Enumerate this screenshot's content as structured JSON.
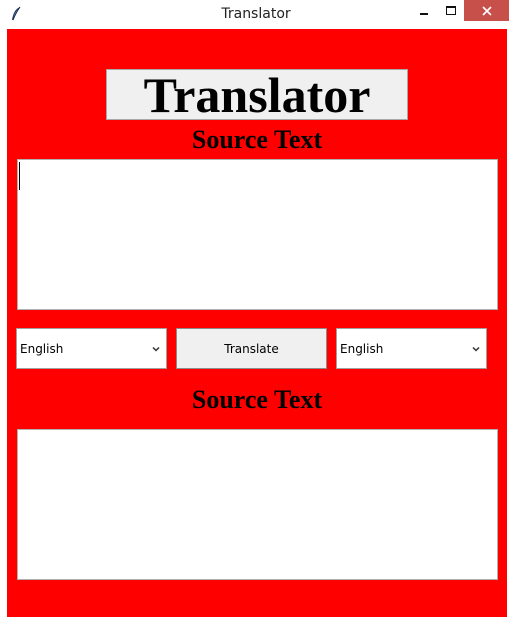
{
  "window": {
    "title": "Translator"
  },
  "app": {
    "heading": "Translator",
    "source_label": "Source Text",
    "output_label": "Source Text",
    "source_text": "",
    "output_text": "",
    "source_language": "English",
    "target_language": "English",
    "translate_label": "Translate"
  },
  "colors": {
    "background": "#ff0000",
    "close_button": "#c7504b",
    "heading_box": "#f0f0f0"
  },
  "icons": {
    "app": "feather-icon",
    "minimize": "minimize-icon",
    "maximize": "maximize-icon",
    "close": "close-icon",
    "dropdown": "chevron-down-icon"
  }
}
